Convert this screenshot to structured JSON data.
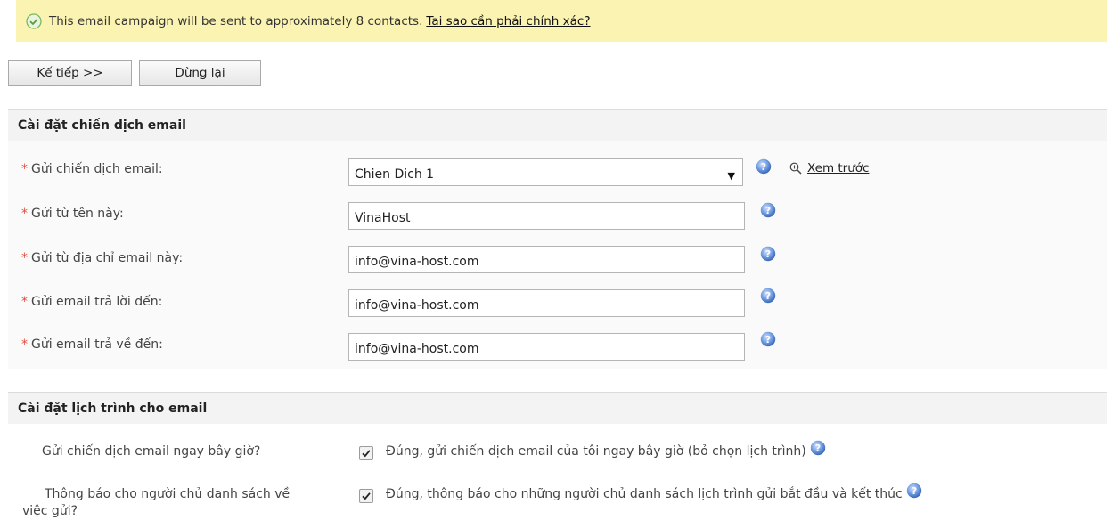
{
  "notice": {
    "text": "This email campaign will be sent to approximately 8 contacts.",
    "link": "Tai sao cần phải chính xác?"
  },
  "buttons": {
    "next": "Kế tiếp >>",
    "stop": "Dừng lại"
  },
  "campaign_settings": {
    "title": "Cài đặt chiến dịch email",
    "campaign_label": "Gửi chiến dịch email:",
    "campaign_value": "Chien Dich 1",
    "preview": "Xem trước",
    "from_name_label": "Gửi từ tên này:",
    "from_name_value": "VinaHost",
    "from_email_label": "Gửi từ địa chỉ email này:",
    "from_email_value": "info@vina-host.com",
    "reply_label": "Gửi email trả lời đến:",
    "reply_value": "info@vina-host.com",
    "bounce_label": "Gửi email trả về đến:",
    "bounce_value": "info@vina-host.com",
    "required_mark": "*"
  },
  "schedule_settings": {
    "title": "Cài đặt lịch trình cho email",
    "send_now_label": "Gửi chiến dịch email ngay bây giờ?",
    "send_now_option": "Đúng, gửi chiến dịch email của tôi ngay bây giờ (bỏ chọn lịch trình)",
    "notify_label_1": "Thông báo cho người chủ danh sách về",
    "notify_label_2": "việc gửi?",
    "notify_option": "Đúng, thông báo cho những người chủ danh sách lịch trình gửi bắt đầu và kết thúc"
  },
  "colors": {
    "notice_bg": "#fbf3b1",
    "required": "#e24b3b",
    "help_blue": "#3f78c8"
  }
}
